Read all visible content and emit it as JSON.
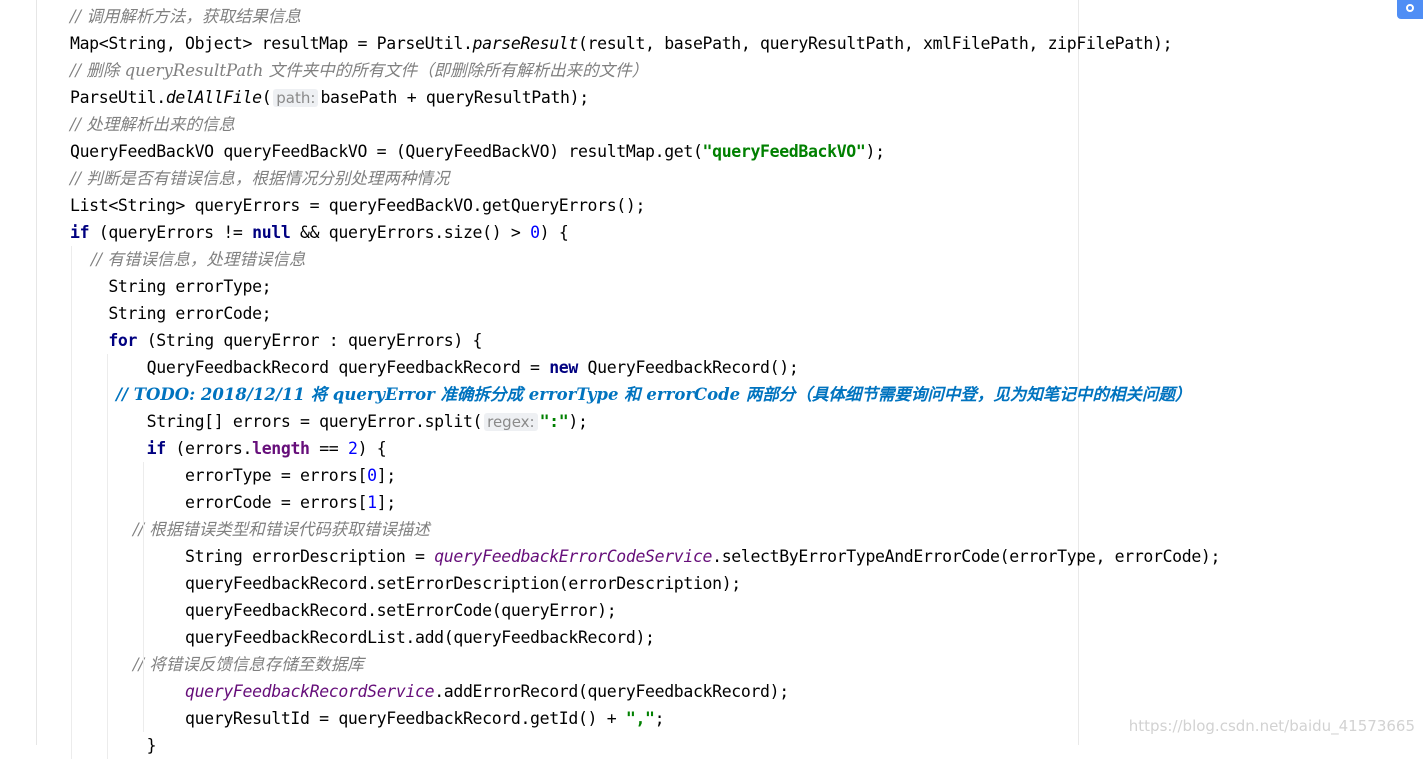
{
  "editor": {
    "lines": [
      {
        "tokens": [
          {
            "t": "// 调用解析方法，获取结果信息",
            "k": "comment"
          }
        ]
      },
      {
        "tokens": [
          {
            "t": "Map<String, Object> resultMap = ParseUtil.",
            "k": "plain"
          },
          {
            "t": "parseResult",
            "k": "static"
          },
          {
            "t": "(result, basePath, queryResultPath, xmlFilePath, zipFilePath);",
            "k": "plain"
          }
        ]
      },
      {
        "tokens": [
          {
            "t": "// 删除 queryResultPath 文件夹中的所有文件（即删除所有解析出来的文件）",
            "k": "comment"
          }
        ]
      },
      {
        "tokens": [
          {
            "t": "ParseUtil.",
            "k": "plain"
          },
          {
            "t": "delAllFile",
            "k": "static"
          },
          {
            "t": "(",
            "k": "plain"
          },
          {
            "t": "path:",
            "k": "hint"
          },
          {
            "t": "basePath + queryResultPath);",
            "k": "plain"
          }
        ]
      },
      {
        "tokens": [
          {
            "t": "// 处理解析出来的信息",
            "k": "comment"
          }
        ]
      },
      {
        "tokens": [
          {
            "t": "QueryFeedBackVO queryFeedBackVO = (QueryFeedBackVO) resultMap.get(",
            "k": "plain"
          },
          {
            "t": "\"queryFeedBackVO\"",
            "k": "string"
          },
          {
            "t": ");",
            "k": "plain"
          }
        ]
      },
      {
        "tokens": [
          {
            "t": "// 判断是否有错误信息，根据情况分别处理两种情况",
            "k": "comment"
          }
        ]
      },
      {
        "tokens": [
          {
            "t": "List<String> queryErrors = queryFeedBackVO.getQueryErrors();",
            "k": "plain"
          }
        ]
      },
      {
        "tokens": [
          {
            "t": "if",
            "k": "keyword"
          },
          {
            "t": " (queryErrors != ",
            "k": "plain"
          },
          {
            "t": "null",
            "k": "keyword"
          },
          {
            "t": " && queryErrors.size() > ",
            "k": "plain"
          },
          {
            "t": "0",
            "k": "number"
          },
          {
            "t": ") {",
            "k": "plain"
          }
        ]
      },
      {
        "tokens": [
          {
            "t": "    // 有错误信息，处理错误信息",
            "k": "comment"
          }
        ]
      },
      {
        "tokens": [
          {
            "t": "    String errorType;",
            "k": "plain"
          }
        ]
      },
      {
        "tokens": [
          {
            "t": "    String errorCode;",
            "k": "plain"
          }
        ]
      },
      {
        "tokens": [
          {
            "t": "    ",
            "k": "plain"
          },
          {
            "t": "for",
            "k": "keyword"
          },
          {
            "t": " (String queryError : queryErrors) {",
            "k": "plain"
          }
        ]
      },
      {
        "tokens": [
          {
            "t": "        QueryFeedbackRecord queryFeedbackRecord = ",
            "k": "plain"
          },
          {
            "t": "new",
            "k": "keyword"
          },
          {
            "t": " QueryFeedbackRecord();",
            "k": "plain"
          }
        ]
      },
      {
        "tokens": [
          {
            "t": "        // TODO: 2018/12/11 将 queryError 准确拆分成 errorType 和 errorCode 两部分（具体细节需要询问中登，见为知笔记中的相关问题）",
            "k": "todo"
          }
        ]
      },
      {
        "tokens": [
          {
            "t": "        String[] errors = queryError.split(",
            "k": "plain"
          },
          {
            "t": "regex:",
            "k": "hint"
          },
          {
            "t": "\":\"",
            "k": "string"
          },
          {
            "t": ");",
            "k": "plain"
          }
        ]
      },
      {
        "tokens": [
          {
            "t": "        ",
            "k": "plain"
          },
          {
            "t": "if",
            "k": "keyword"
          },
          {
            "t": " (errors.",
            "k": "plain"
          },
          {
            "t": "length",
            "k": "field"
          },
          {
            "t": " == ",
            "k": "plain"
          },
          {
            "t": "2",
            "k": "number"
          },
          {
            "t": ") {",
            "k": "plain"
          }
        ]
      },
      {
        "tokens": [
          {
            "t": "            errorType = errors[",
            "k": "plain"
          },
          {
            "t": "0",
            "k": "number"
          },
          {
            "t": "];",
            "k": "plain"
          }
        ]
      },
      {
        "tokens": [
          {
            "t": "            errorCode = errors[",
            "k": "plain"
          },
          {
            "t": "1",
            "k": "number"
          },
          {
            "t": "];",
            "k": "plain"
          }
        ]
      },
      {
        "tokens": [
          {
            "t": "            // 根据错误类型和错误代码获取错误描述",
            "k": "comment"
          }
        ]
      },
      {
        "tokens": [
          {
            "t": "            String errorDescription = ",
            "k": "plain"
          },
          {
            "t": "queryFeedbackErrorCodeService",
            "k": "service"
          },
          {
            "t": ".selectByErrorTypeAndErrorCode(errorType, errorCode);",
            "k": "plain"
          }
        ]
      },
      {
        "tokens": [
          {
            "t": "            queryFeedbackRecord.setErrorDescription(errorDescription);",
            "k": "plain"
          }
        ]
      },
      {
        "tokens": [
          {
            "t": "            queryFeedbackRecord.setErrorCode(queryError);",
            "k": "plain"
          }
        ]
      },
      {
        "tokens": [
          {
            "t": "            queryFeedbackRecordList.add(queryFeedbackRecord);",
            "k": "plain"
          }
        ]
      },
      {
        "tokens": [
          {
            "t": "            // 将错误反馈信息存储至数据库",
            "k": "comment"
          }
        ]
      },
      {
        "tokens": [
          {
            "t": "            ",
            "k": "plain"
          },
          {
            "t": "queryFeedbackRecordService",
            "k": "service"
          },
          {
            "t": ".addErrorRecord(queryFeedbackRecord);",
            "k": "plain"
          }
        ]
      },
      {
        "tokens": [
          {
            "t": "            queryResultId = queryFeedbackRecord.getId() + ",
            "k": "plain"
          },
          {
            "t": "\",\"",
            "k": "string"
          },
          {
            "t": ";",
            "k": "plain"
          }
        ]
      },
      {
        "tokens": [
          {
            "t": "        }",
            "k": "plain"
          }
        ]
      }
    ]
  },
  "watermark": "https://blog.csdn.net/baidu_41573665",
  "colors": {
    "keyword": "#000080",
    "string": "#008000",
    "comment": "#808080",
    "todo": "#0073bf",
    "field": "#660e7a",
    "number": "#0000ff",
    "badge": "#4f8ef5"
  }
}
